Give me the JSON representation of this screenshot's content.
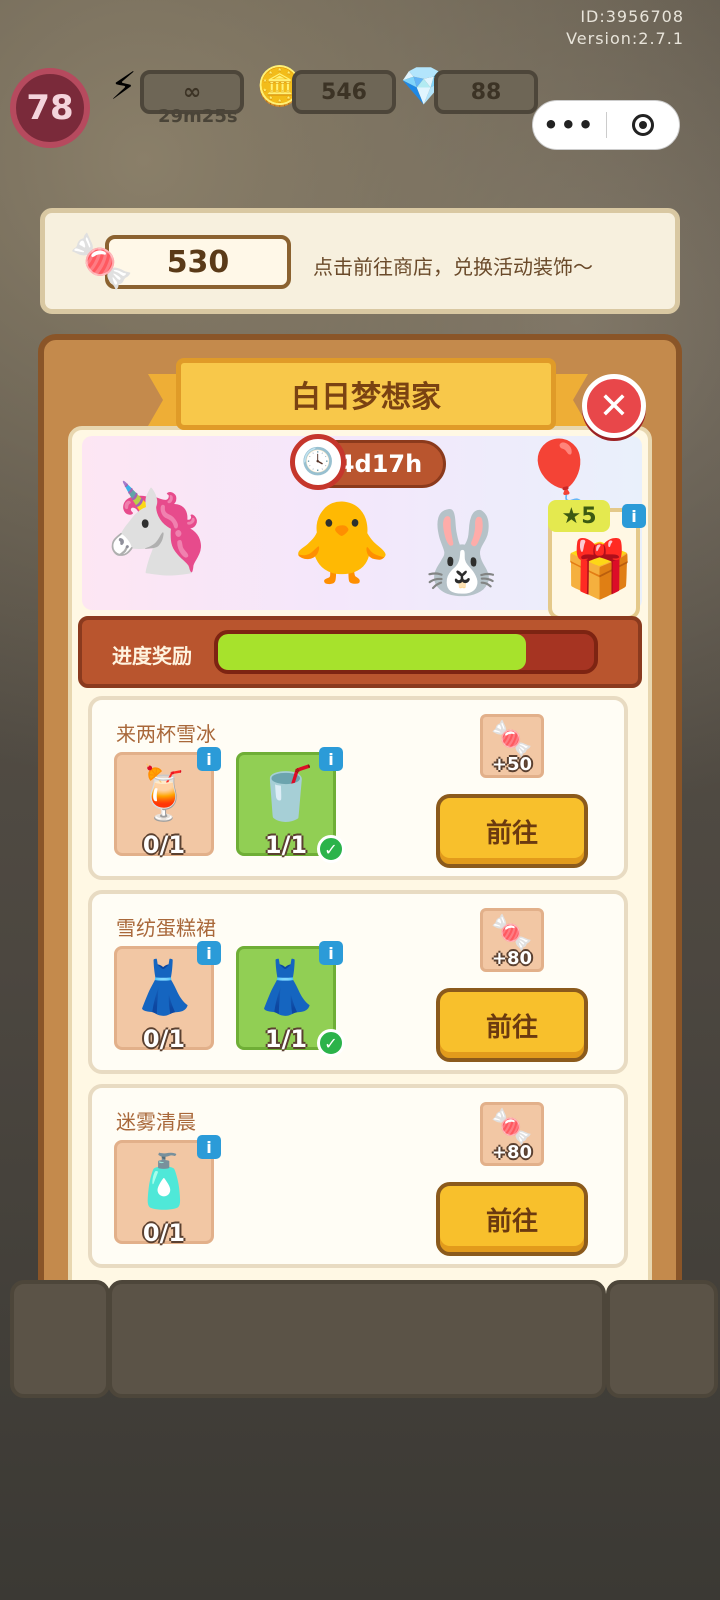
{
  "meta": {
    "id_text": "ID:3956708",
    "version_text": "Version:2.7.1"
  },
  "hud": {
    "level": "78",
    "energy": "∞",
    "energy_timer": "29m25s",
    "coins": "546",
    "gems": "88"
  },
  "banner": {
    "candy_count": "530",
    "hint": "点击前往商店，兑换活动装饰～"
  },
  "panel": {
    "title": "白日梦想家",
    "timer": "4d17h",
    "gift_stars": "5",
    "progress_label": "进度奖励",
    "progress_value": 0.82
  },
  "tasks": [
    {
      "title": "来两杯雪冰",
      "reward": "+50",
      "button": "前往",
      "items": [
        {
          "icon": "melon-soda-icon",
          "count": "0/1",
          "done": false
        },
        {
          "icon": "strawberry-milkshake-icon",
          "count": "1/1",
          "done": true
        }
      ]
    },
    {
      "title": "雪纺蛋糕裙",
      "reward": "+80",
      "button": "前往",
      "items": [
        {
          "icon": "white-dress-icon",
          "count": "0/1",
          "done": false
        },
        {
          "icon": "purple-dress-icon",
          "count": "1/1",
          "done": true
        }
      ]
    },
    {
      "title": "迷雾清晨",
      "reward": "+80",
      "button": "前往",
      "items": [
        {
          "icon": "pink-perfume-icon",
          "count": "0/1",
          "done": false
        }
      ]
    }
  ]
}
